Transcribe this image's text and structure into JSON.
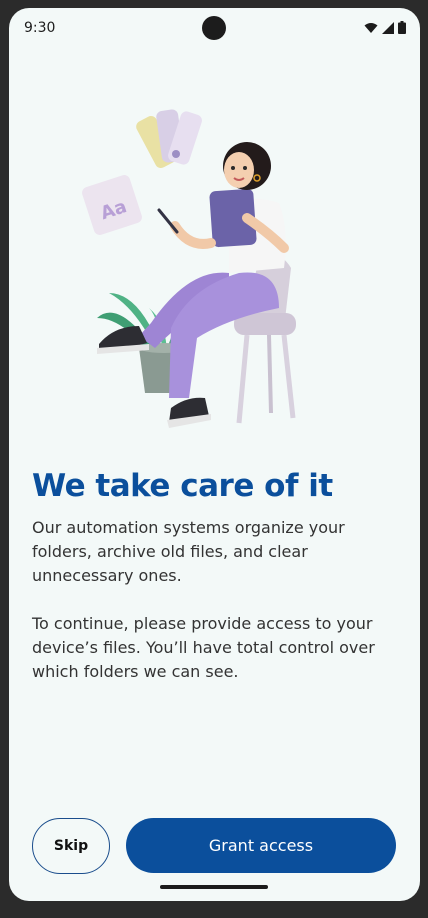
{
  "status_bar": {
    "time": "9:30"
  },
  "content": {
    "headline": "We take care of it",
    "paragraph_1": "Our automation systems organize your folders, archive old files, and clear unnecessary ones.",
    "paragraph_2": "To continue, please provide access to your device’s files. You’ll have total control over which folders we can see."
  },
  "actions": {
    "skip_label": "Skip",
    "grant_label": "Grant access"
  },
  "colors": {
    "accent": "#0b4f9c",
    "background": "#f3f9f8"
  },
  "icons": [
    "wifi-icon",
    "signal-icon",
    "battery-icon"
  ]
}
